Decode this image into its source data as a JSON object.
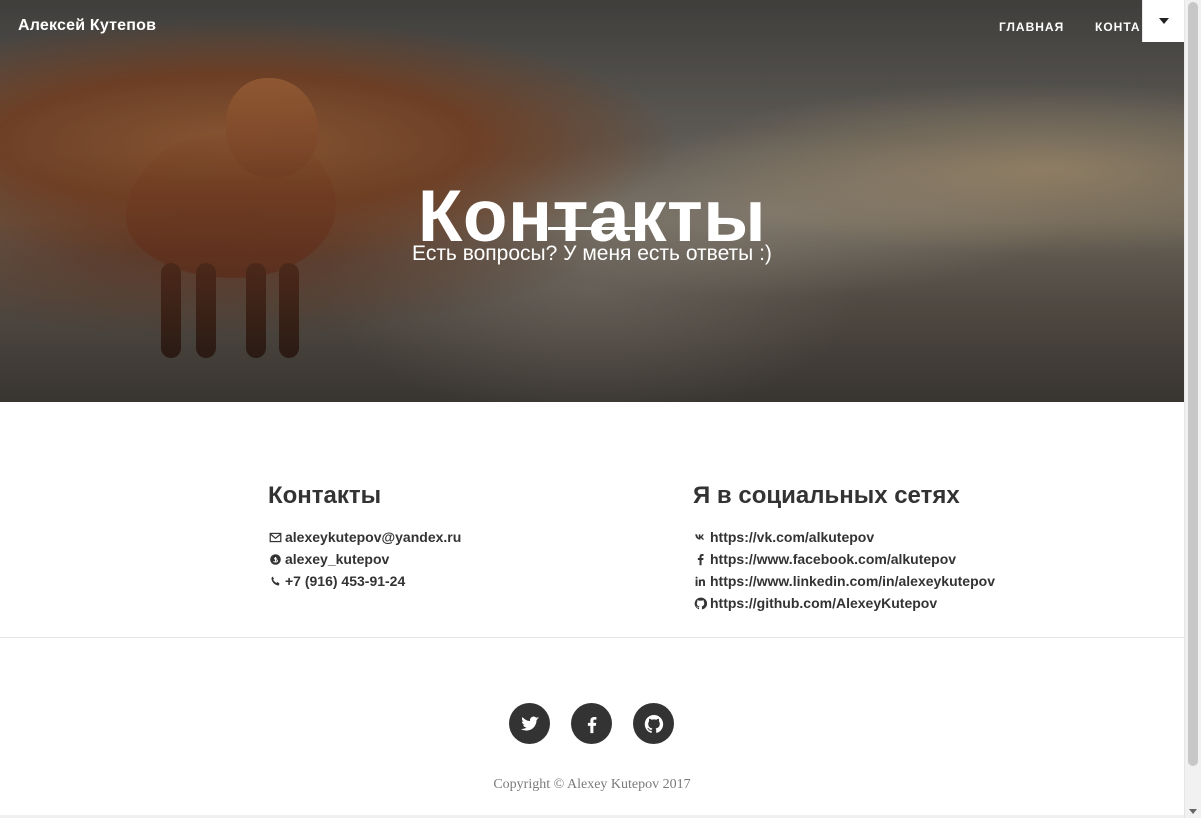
{
  "navbar": {
    "brand": "Алексей Кутепов",
    "links": {
      "home": "ГЛАВНАЯ",
      "contacts": "КОНТАКТЫ"
    },
    "dropdown_icon": "caret-down-icon"
  },
  "hero": {
    "title": "Контакты",
    "subtitle": "Есть вопросы? У меня есть ответы :)"
  },
  "contacts_section": {
    "title": "Контакты",
    "items": [
      {
        "icon": "envelope-icon",
        "text": "alexeykutepov@yandex.ru"
      },
      {
        "icon": "skype-icon",
        "text": "alexey_kutepov"
      },
      {
        "icon": "phone-icon",
        "text": "+7 (916) 453-91-24"
      }
    ]
  },
  "social_section": {
    "title": "Я в социальных сетях",
    "items": [
      {
        "icon": "vk-icon",
        "text": "https://vk.com/alkutepov"
      },
      {
        "icon": "facebook-icon",
        "text": "https://www.facebook.com/alkutepov"
      },
      {
        "icon": "linkedin-icon",
        "text": "https://www.linkedin.com/in/alexeykutepov"
      },
      {
        "icon": "github-icon",
        "text": "https://github.com/AlexeyKutepov"
      }
    ]
  },
  "footer": {
    "social_buttons": [
      {
        "icon": "twitter-icon"
      },
      {
        "icon": "facebook-icon"
      },
      {
        "icon": "github-icon"
      }
    ],
    "copyright": "Copyright © Alexey Kutepov 2017"
  },
  "colors": {
    "text_dark": "#333333",
    "text_muted": "#7a7a7a",
    "white": "#ffffff"
  }
}
